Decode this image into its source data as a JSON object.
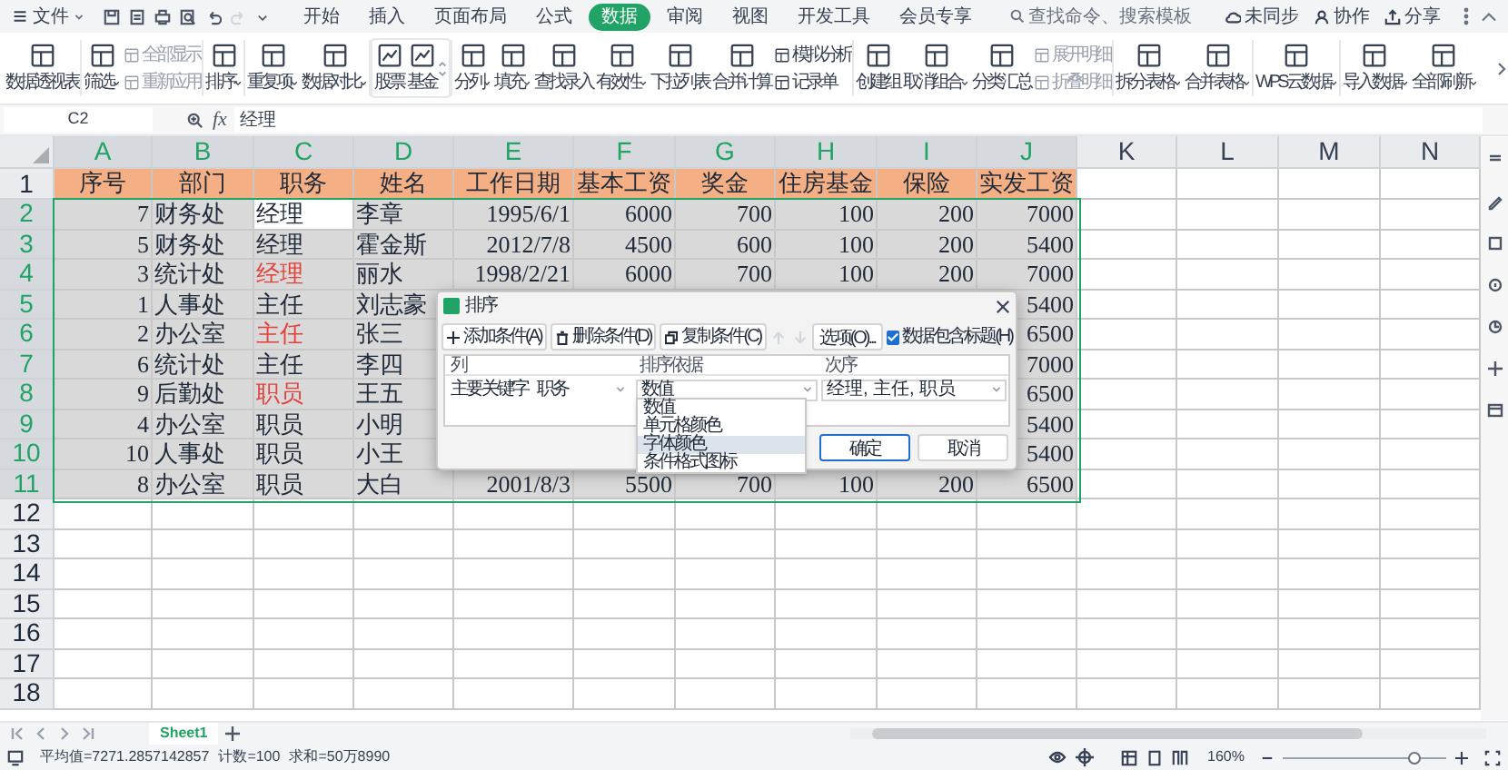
{
  "menu_bar": {
    "file_menu": "文件",
    "tabs": [
      {
        "label": "开始",
        "selected": false
      },
      {
        "label": "插入",
        "selected": false
      },
      {
        "label": "页面布局",
        "selected": false
      },
      {
        "label": "公式",
        "selected": false
      },
      {
        "label": "数据",
        "selected": true
      },
      {
        "label": "审阅",
        "selected": false
      },
      {
        "label": "视图",
        "selected": false
      },
      {
        "label": "开发工具",
        "selected": false
      },
      {
        "label": "会员专享",
        "selected": false
      }
    ],
    "search": {
      "placeholder": "查找命令、搜索模板"
    },
    "actions": [
      "未同步",
      "协作",
      "分享"
    ]
  },
  "ribbon": {
    "groups": [
      {
        "kind": "plain",
        "items": [
          {
            "kind": "large",
            "label": "数据透视表",
            "caret": false,
            "disabled": false
          }
        ]
      },
      {
        "kind": "plain",
        "items": [
          {
            "kind": "large",
            "label": "筛选",
            "caret": true,
            "disabled": false
          },
          {
            "kind": "small",
            "label": "全部显示",
            "caret": false,
            "disabled": true
          },
          {
            "kind": "small",
            "label": "重新应用",
            "caret": false,
            "disabled": true
          }
        ]
      },
      {
        "kind": "plain",
        "items": [
          {
            "kind": "large",
            "label": "排序",
            "caret": true,
            "disabled": false
          }
        ]
      },
      {
        "kind": "plain",
        "items": [
          {
            "kind": "large",
            "label": "重复项",
            "caret": true,
            "disabled": false
          },
          {
            "kind": "large",
            "label": "数据对比",
            "caret": true,
            "disabled": false
          }
        ]
      },
      {
        "kind": "gallery",
        "items": [
          {
            "kind": "large",
            "label": "股票",
            "caret": false,
            "disabled": false
          },
          {
            "kind": "large",
            "label": "基金",
            "caret": false,
            "disabled": false
          }
        ]
      },
      {
        "kind": "plain",
        "items": [
          {
            "kind": "large",
            "label": "分列",
            "caret": true,
            "disabled": false
          },
          {
            "kind": "large",
            "label": "填充",
            "caret": true,
            "disabled": false
          },
          {
            "kind": "large",
            "label": "查找录入",
            "caret": false,
            "disabled": false
          },
          {
            "kind": "large",
            "label": "有效性",
            "caret": true,
            "disabled": false
          },
          {
            "kind": "large",
            "label": "下拉列表",
            "caret": false,
            "disabled": false
          },
          {
            "kind": "large",
            "label": "合并计算",
            "caret": false,
            "disabled": false
          },
          {
            "kind": "small",
            "label": "模拟分析",
            "caret": false,
            "disabled": false
          },
          {
            "kind": "small",
            "label": "记录单",
            "caret": false,
            "disabled": false
          }
        ]
      },
      {
        "kind": "plain",
        "items": [
          {
            "kind": "large",
            "label": "创建组",
            "caret": false,
            "disabled": false
          },
          {
            "kind": "large",
            "label": "取消组合",
            "caret": true,
            "disabled": false
          },
          {
            "kind": "large",
            "label": "分类汇总",
            "caret": false,
            "disabled": false
          },
          {
            "kind": "small",
            "label": "展开明细",
            "caret": false,
            "disabled": true
          },
          {
            "kind": "small",
            "label": "折叠明细",
            "caret": false,
            "disabled": true
          }
        ]
      },
      {
        "kind": "plain",
        "items": [
          {
            "kind": "large",
            "label": "拆分表格",
            "caret": true,
            "disabled": false
          },
          {
            "kind": "large",
            "label": "合并表格",
            "caret": true,
            "disabled": false
          }
        ]
      },
      {
        "kind": "plain",
        "items": [
          {
            "kind": "large",
            "label": "WPS云数据",
            "caret": true,
            "disabled": false
          }
        ]
      },
      {
        "kind": "plain",
        "items": [
          {
            "kind": "large",
            "label": "导入数据",
            "caret": true,
            "disabled": false
          },
          {
            "kind": "large",
            "label": "全部刷新",
            "caret": true,
            "disabled": false
          }
        ]
      }
    ]
  },
  "formula_bar": {
    "cell_name": "C2",
    "fx": "fx",
    "value": "经理"
  },
  "sheet": {
    "columns": [
      {
        "label": "A",
        "selected": true
      },
      {
        "label": "B",
        "selected": true
      },
      {
        "label": "C",
        "selected": true
      },
      {
        "label": "D",
        "selected": true
      },
      {
        "label": "E",
        "selected": true
      },
      {
        "label": "F",
        "selected": true
      },
      {
        "label": "G",
        "selected": true
      },
      {
        "label": "H",
        "selected": true
      },
      {
        "label": "I",
        "selected": true
      },
      {
        "label": "J",
        "selected": true
      },
      {
        "label": "K",
        "selected": false
      },
      {
        "label": "L",
        "selected": false
      },
      {
        "label": "M",
        "selected": false
      },
      {
        "label": "N",
        "selected": false
      }
    ],
    "rows": [
      {
        "number": "1",
        "kind": "header",
        "selected": false,
        "cells": [
          "序号",
          "部门",
          "职务",
          "姓名",
          "工作日期",
          "基本工资",
          "奖金",
          "住房基金",
          "保险",
          "实发工资"
        ]
      },
      {
        "number": "2",
        "kind": "data",
        "selected": true,
        "cells": [
          "7",
          "财务处",
          {
            "text": "经理",
            "active": true
          },
          "李章",
          "1995/6/1",
          "6000",
          "700",
          "100",
          "200",
          "7000"
        ]
      },
      {
        "number": "3",
        "kind": "data",
        "selected": true,
        "cells": [
          "5",
          "财务处",
          "经理",
          "霍金斯",
          "2012/7/8",
          "4500",
          "600",
          "100",
          "200",
          "5400"
        ]
      },
      {
        "number": "4",
        "kind": "data",
        "selected": true,
        "cells": [
          "3",
          "统计处",
          {
            "text": "经理",
            "color": "#e5403a"
          },
          "丽水",
          "1998/2/21",
          "6000",
          "700",
          "100",
          "200",
          "7000"
        ]
      },
      {
        "number": "5",
        "kind": "data",
        "selected": true,
        "cells": [
          "1",
          "人事处",
          "主任",
          "刘志豪",
          null,
          null,
          null,
          null,
          null,
          "5400"
        ]
      },
      {
        "number": "6",
        "kind": "data",
        "selected": true,
        "cells": [
          "2",
          "办公室",
          {
            "text": "主任",
            "color": "#e5403a"
          },
          "张三",
          null,
          null,
          null,
          null,
          null,
          "6500"
        ]
      },
      {
        "number": "7",
        "kind": "data",
        "selected": true,
        "cells": [
          "6",
          "统计处",
          "主任",
          "李四",
          null,
          null,
          null,
          null,
          null,
          "7000"
        ]
      },
      {
        "number": "8",
        "kind": "data",
        "selected": true,
        "cells": [
          "9",
          "后勤处",
          {
            "text": "职员",
            "color": "#e5403a"
          },
          "王五",
          null,
          null,
          null,
          null,
          null,
          "6500"
        ]
      },
      {
        "number": "9",
        "kind": "data",
        "selected": true,
        "cells": [
          "4",
          "办公室",
          "职员",
          "小明",
          null,
          null,
          null,
          null,
          null,
          "5400"
        ]
      },
      {
        "number": "10",
        "kind": "data",
        "selected": true,
        "cells": [
          "10",
          "人事处",
          "职员",
          "小王",
          null,
          null,
          null,
          null,
          null,
          "5400"
        ]
      },
      {
        "number": "11",
        "kind": "data",
        "selected": true,
        "cells": [
          "8",
          "办公室",
          "职员",
          "大白",
          "2001/8/3",
          "5500",
          "700",
          "100",
          "200",
          "6500"
        ]
      },
      {
        "number": "12",
        "kind": "empty",
        "selected": false,
        "cells": []
      },
      {
        "number": "13",
        "kind": "empty",
        "selected": false,
        "cells": []
      },
      {
        "number": "14",
        "kind": "empty",
        "selected": false,
        "cells": []
      },
      {
        "number": "15",
        "kind": "empty",
        "selected": false,
        "cells": []
      },
      {
        "number": "16",
        "kind": "empty",
        "selected": false,
        "cells": []
      },
      {
        "number": "17",
        "kind": "empty",
        "selected": false,
        "cells": []
      },
      {
        "number": "18",
        "kind": "empty",
        "selected": false,
        "cells": []
      }
    ]
  },
  "sort_dialog": {
    "title": "排序",
    "toolbar": [
      "添加条件(A)",
      "删除条件(D)",
      "复制条件(C)"
    ],
    "move_buttons": [
      {
        "disabled": true
      },
      {
        "disabled": true
      }
    ],
    "options_button": "选项(O)...",
    "has_header": {
      "label": "数据包含标题(H)",
      "checked": true
    },
    "columns": [
      "列",
      "排序依据",
      "次序"
    ],
    "rule": {
      "label": "主要关键字",
      "column": "职务",
      "sort_on": "数值",
      "order": "经理, 主任, 职员"
    },
    "sort_on_options": [
      {
        "label": "数值",
        "selected": false
      },
      {
        "label": "单元格颜色",
        "selected": false
      },
      {
        "label": "字体颜色",
        "selected": true
      },
      {
        "label": "条件格式图标",
        "selected": false
      }
    ],
    "buttons": [
      "确定",
      "取消"
    ]
  },
  "sheet_tabs": [
    {
      "label": "Sheet1",
      "selected": true
    }
  ],
  "status_bar": {
    "stats": [
      "平均值=7271.2857142857",
      "计数=100",
      "求和=50万8990"
    ],
    "zoom": "160%",
    "zoom_slider": {
      "level": 0.8
    }
  }
}
